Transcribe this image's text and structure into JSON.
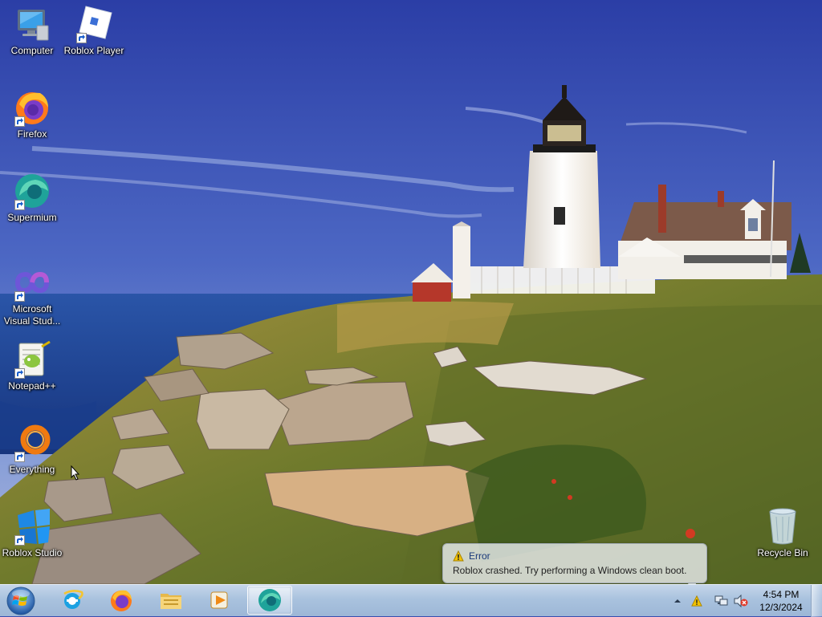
{
  "desktop": {
    "icons": [
      {
        "label": "Computer",
        "icon": "computer-icon",
        "shortcut": false
      },
      {
        "label": "Roblox Player",
        "icon": "roblox-player-icon",
        "shortcut": true
      },
      {
        "label": "Firefox",
        "icon": "firefox-icon",
        "shortcut": true
      },
      {
        "label": "Supermium",
        "icon": "supermium-icon",
        "shortcut": true
      },
      {
        "label": "Microsoft Visual Stud...",
        "icon": "visual-studio-icon",
        "shortcut": true
      },
      {
        "label": "Notepad++",
        "icon": "notepad-plus-plus-icon",
        "shortcut": true
      },
      {
        "label": "Everything",
        "icon": "everything-search-icon",
        "shortcut": true
      },
      {
        "label": "Roblox Studio",
        "icon": "roblox-studio-icon",
        "shortcut": true
      },
      {
        "label": "Recycle Bin",
        "icon": "recycle-bin-icon",
        "shortcut": false
      }
    ]
  },
  "notification": {
    "title": "Error",
    "message": "Roblox crashed. Try performing a Windows clean boot.",
    "icon": "warning-icon"
  },
  "taskbar": {
    "start_icon": "windows-start-orb-icon",
    "pinned": [
      {
        "name": "Internet Explorer",
        "icon": "internet-explorer-icon",
        "active": false
      },
      {
        "name": "Firefox",
        "icon": "firefox-icon",
        "active": false
      },
      {
        "name": "File Explorer",
        "icon": "folder-icon",
        "active": false
      },
      {
        "name": "Windows Media Player",
        "icon": "media-player-icon",
        "active": false
      },
      {
        "name": "Supermium",
        "icon": "supermium-icon",
        "active": true
      }
    ],
    "tray": {
      "icons": [
        "show-hidden-icons-chevron-icon",
        "action-center-warning-icon",
        "network-icon",
        "volume-muted-icon"
      ],
      "time": "4:54 PM",
      "date": "12/3/2024"
    }
  },
  "colors": {
    "taskbar": "#a9c2de",
    "sky_top": "#2c3fa8",
    "sea": "#1e4fa0",
    "warning": "#f2c200"
  }
}
